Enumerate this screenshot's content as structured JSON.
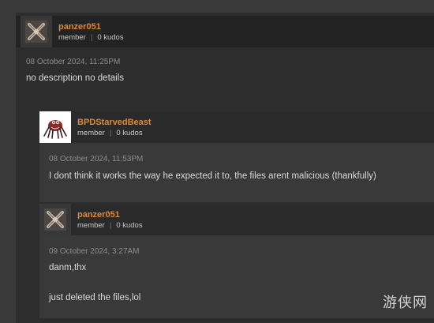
{
  "comments": [
    {
      "username": "panzer051",
      "role": "member",
      "kudos": "0 kudos",
      "timestamp": "08 October 2024, 11:25PM",
      "text": "no description no details",
      "avatar_icon": "crossed-tools-icon"
    },
    {
      "username": "BPDStarvedBeast",
      "role": "member",
      "kudos": "0 kudos",
      "timestamp": "08 October 2024, 11:53PM",
      "text": "I dont think it works the way he expected it to, the files arent malicious (thankfully)",
      "avatar_icon": "creature-icon"
    },
    {
      "username": "panzer051",
      "role": "member",
      "kudos": "0 kudos",
      "timestamp": "09 October 2024, 3:27AM",
      "text_line1": "danm,thx",
      "text_line2": "just deleted the files,lol",
      "avatar_icon": "crossed-tools-icon"
    }
  ],
  "separator": "|",
  "watermark": "游侠网",
  "colors": {
    "username": "#d98a3d",
    "page_bg": "#3a3a3a",
    "panel_bg": "#2d2d2d",
    "header_bg": "#232323",
    "reply_bg": "#393939"
  }
}
